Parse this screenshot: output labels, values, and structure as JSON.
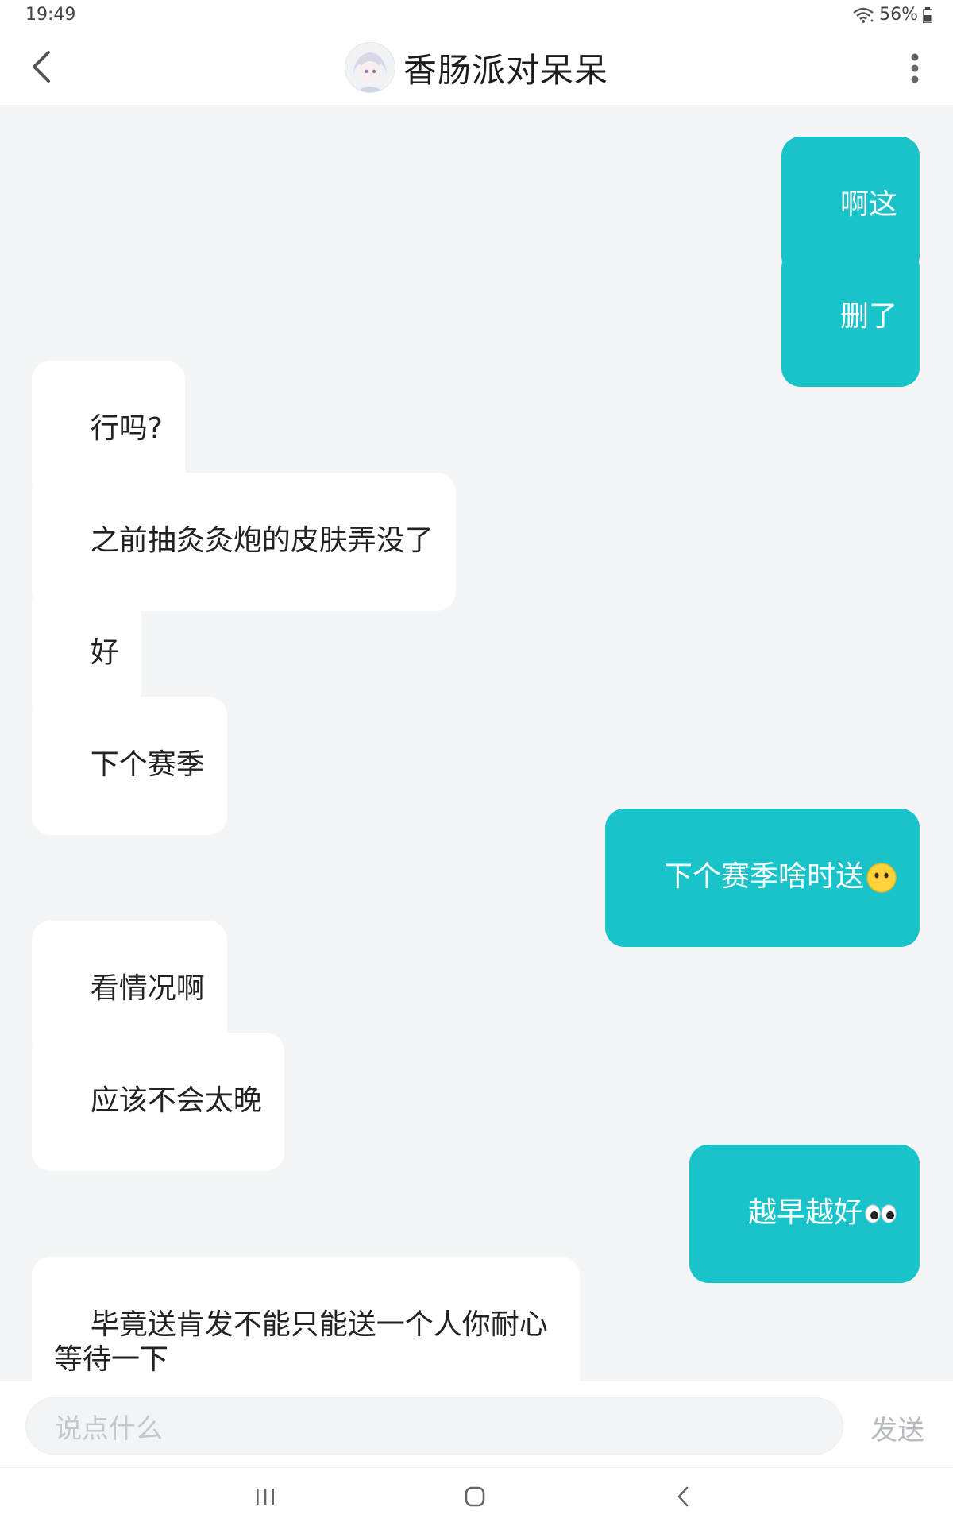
{
  "status_bar": {
    "time": "19:49",
    "battery": "56%",
    "icons": [
      "wifi-icon",
      "battery-icon"
    ]
  },
  "header": {
    "title": "香肠派对呆呆",
    "back_icon": "chevron-left-icon",
    "more_icon": "more-vertical-icon"
  },
  "messages": [
    {
      "side": "right",
      "text": "啊这"
    },
    {
      "side": "right",
      "text": "删了"
    },
    {
      "side": "left",
      "text": "行吗?"
    },
    {
      "side": "left",
      "text": "之前抽灸灸炮的皮肤弄没了"
    },
    {
      "side": "left",
      "text": "好"
    },
    {
      "side": "left",
      "text": "下个赛季"
    },
    {
      "side": "right",
      "text": "下个赛季啥时送",
      "emoji": "neutral-face-emoji"
    },
    {
      "side": "left",
      "text": "看情况啊"
    },
    {
      "side": "left",
      "text": "应该不会太晚"
    },
    {
      "side": "right",
      "text": "越早越好",
      "emoji": "eyes-emoji"
    },
    {
      "side": "left",
      "text": "毕竟送肯发不能只能送一个人你耐心\n等待一下"
    }
  ],
  "input": {
    "placeholder": "说点什么",
    "send_label": "发送"
  },
  "nav": {
    "icons": [
      "recent-apps-icon",
      "home-icon",
      "back-icon"
    ]
  },
  "colors": {
    "outgoing_bubble": "#18c3c9",
    "incoming_bubble": "#ffffff",
    "background": "#f4f5f7"
  }
}
